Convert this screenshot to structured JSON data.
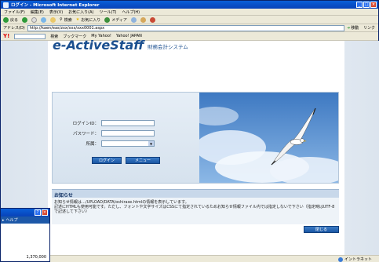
{
  "window": {
    "title": "ログイン - Microsoft Internet Explorer"
  },
  "menu": [
    "ファイル(F)",
    "編集(E)",
    "表示(V)",
    "お気に入り(A)",
    "ツール(T)",
    "ヘルプ(H)"
  ],
  "toolbar": {
    "back": "戻る",
    "search": "検索",
    "favorites": "お気に入り",
    "media": "メディア"
  },
  "address": {
    "label": "アドレス(D)",
    "url": "http://kaen/eas/zxx/xxx/xxx0001.aspx",
    "go": "移動",
    "links": "リンク"
  },
  "yahoo": {
    "logo": "Y!",
    "search_btn": "検索",
    "bookmarks": "ブックマーク",
    "my_yahoo": "My Yahoo!",
    "yahoo_japan": "Yahoo! JAPAN"
  },
  "page": {
    "logo": "e-ActiveStaff",
    "logo_sub": "財務会計システム",
    "login_id_label": "ログインID：",
    "password_label": "パスワード：",
    "affiliation_label": "所属：",
    "login_button": "ログイン",
    "menu_button": "メニュー",
    "notice_title": "お知らせ",
    "notice_text_1": "お知らせ情報は…/UPLOAD/DATA/oshirase.htmlの情報を表示しています。",
    "notice_text_2": "記述にHTMLも使用可能です。ただし、フォントや文字サイズはCSSにて指定されているためお知らせ情報ファイル内では指定しないで下さい（指定時はUTF-8で記述して下さい）",
    "close_button": "閉じる"
  },
  "status": {
    "zone": "イントラネット"
  },
  "popup": {
    "help": "ヘルプ",
    "value": "1,370,000"
  },
  "colors": {
    "brand": "#1b4f8f",
    "button": "#1a56a4"
  }
}
